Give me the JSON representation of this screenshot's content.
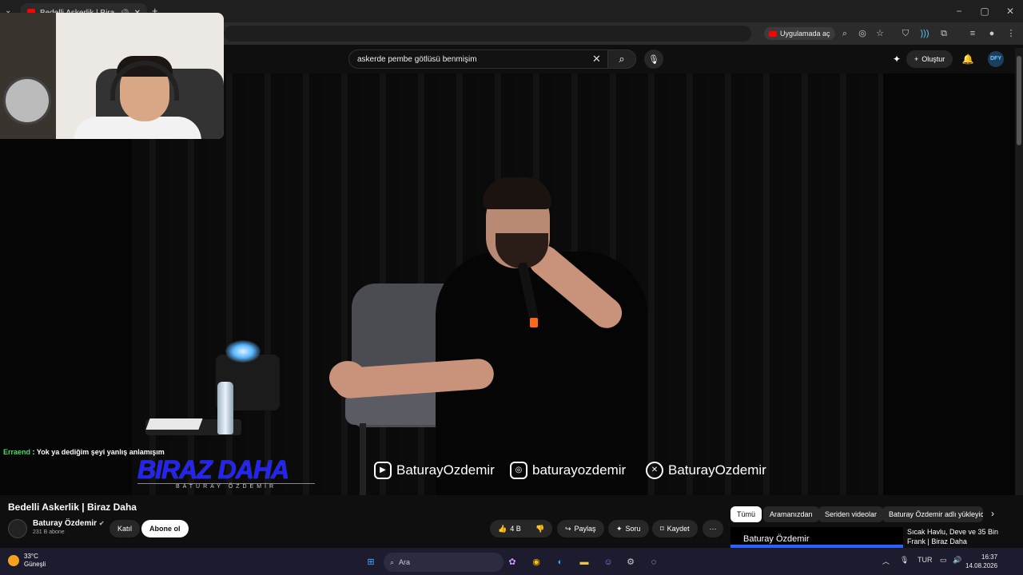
{
  "browser": {
    "tab_title": "Bedelli Askerlik | Biraz Daha",
    "open_app_label": "Uygulamada aç",
    "window_controls": [
      "−",
      "▢",
      "✕"
    ]
  },
  "youtube": {
    "search_value": "askerde pembe götlüsü benmişim",
    "create_label": "Oluştur",
    "avatar_text": "DFY"
  },
  "video": {
    "chat_user": "Erraend",
    "chat_message": "Yok ya dediğim şeyi yanlış anlamışım",
    "brand_main": "BIRAZ DAHA",
    "brand_sub": "BATURAY ÖZDEMİR",
    "social": [
      {
        "icon": "youtube-icon",
        "handle": "BaturayOzdemir"
      },
      {
        "icon": "instagram-icon",
        "handle": "baturayozdemir"
      },
      {
        "icon": "x-icon",
        "handle": "BaturayOzdemir"
      }
    ]
  },
  "details": {
    "title": "Bedelli Askerlik | Biraz Daha",
    "channel": "Baturay Özdemir",
    "subscribers": "231 B abone",
    "join_label": "Katıl",
    "subscribe_label": "Abone ol",
    "likes": "4 B",
    "share_label": "Paylaş",
    "ask_label": "Soru",
    "save_label": "Kaydet"
  },
  "chips": [
    "Tümü",
    "Aramanızdan",
    "Seriden videolar",
    "Baturay Özdemir adlı yükleyicid"
  ],
  "recommendation": {
    "thumb_text": "Baturay Özdemir",
    "title": "Sıcak Havlu, Deve ve 35 Bin Frank | Biraz Daha"
  },
  "taskbar": {
    "temperature": "33°C",
    "weather": "Güneşli",
    "search_placeholder": "Ara",
    "language": "TUR",
    "time": "16:37",
    "date": "14.08.2026"
  },
  "colors": {
    "youtube_red": "#ff0000",
    "brand_blue": "#2222ff",
    "chat_user_green": "#4cd964"
  }
}
